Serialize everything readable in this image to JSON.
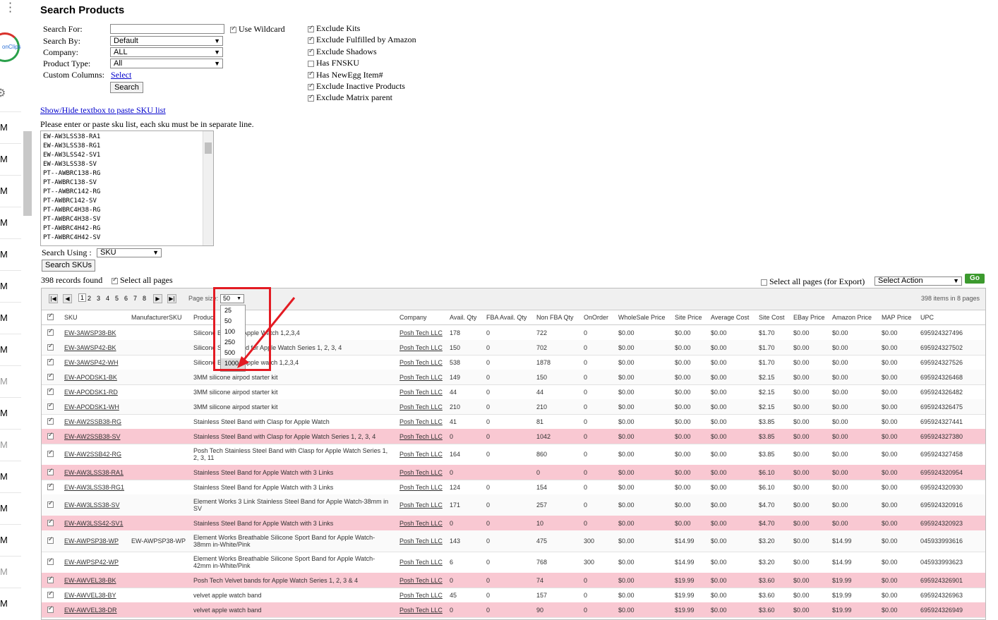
{
  "page_title": "Search Products",
  "form": {
    "search_for_label": "Search For:",
    "search_for_value": "",
    "use_wildcard_label": "Use Wildcard",
    "search_by_label": "Search By:",
    "search_by_value": "Default",
    "company_label": "Company:",
    "company_value": "ALL",
    "product_type_label": "Product Type:",
    "product_type_value": "All",
    "custom_columns_label": "Custom Columns:",
    "custom_columns_link": "Select",
    "search_button": "Search"
  },
  "filters": [
    {
      "label": "Exclude Kits",
      "checked": true
    },
    {
      "label": "Exclude Fulfilled by Amazon",
      "checked": true
    },
    {
      "label": "Exclude Shadows",
      "checked": true
    },
    {
      "label": "Has FNSKU",
      "checked": false
    },
    {
      "label": "Has NewEgg Item#",
      "checked": true
    },
    {
      "label": "Exclude Inactive Products",
      "checked": true
    },
    {
      "label": "Exclude Matrix parent",
      "checked": true
    }
  ],
  "sku_list": {
    "toggle_link": "Show/Hide textbox to paste SKU list",
    "instruction": "Please enter or paste sku list, each sku must be in separate line.",
    "lines": [
      "EW-AW3LSS38-RA1",
      "EW-AW3LSS38-RG1",
      "EW-AW3LSS42-SV1",
      "EW-AW3LSS38-SV",
      "PT--AWBRC138-RG",
      "PT-AWBRC138-SV",
      "PT--AWBRC142-RG",
      "PT-AWBRC142-SV",
      "PT-AWBRC4H38-RG",
      "PT-AWBRC4H38-SV",
      "PT-AWBRC4H42-RG",
      "PT-AWBRC4H42-SV"
    ],
    "search_using_label": "Search Using :",
    "search_using_value": "SKU",
    "search_skus_button": "Search SKUs"
  },
  "records": {
    "found_text": "398 records found",
    "select_all_label": "Select all pages",
    "export_label": "Select all pages (for Export)",
    "action_value": "Select Action",
    "go_button": "Go"
  },
  "pager": {
    "pages": [
      "1",
      "2",
      "3",
      "4",
      "5",
      "6",
      "7",
      "8"
    ],
    "current_page": "1",
    "page_size_label": "Page size:",
    "page_size_value": "50",
    "page_size_options": [
      "25",
      "50",
      "100",
      "250",
      "500",
      "1000"
    ],
    "summary": "398 items in 8 pages"
  },
  "columns": [
    "SKU",
    "ManufacturerSKU",
    "Product",
    "Company",
    "Avail. Qty",
    "FBA Avail. Qty",
    "Non FBA Qty",
    "OnOrder",
    "WholeSale Price",
    "Site Price",
    "Average Cost",
    "Site Cost",
    "EBay Price",
    "Amazon Price",
    "MAP Price",
    "UPC"
  ],
  "rows": [
    {
      "sku": "EW-3AWSP38-BK",
      "msku": "",
      "product": "Silicone Band for Apple Watch 1,2,3,4",
      "company": "Posh Tech LLC",
      "avail": "178",
      "fba": "0",
      "nonfba": "722",
      "onorder": "0",
      "wholesale": "$0.00",
      "site": "$0.00",
      "avg": "$0.00",
      "sitecost": "$1.70",
      "ebay": "$0.00",
      "amazon": "$0.00",
      "map": "$0.00",
      "upc": "695924327496",
      "pink": false
    },
    {
      "sku": "EW-3AWSP42-BK",
      "msku": "",
      "product": "Silicone Sport Band for Apple Watch Series 1, 2, 3, 4",
      "company": "Posh Tech LLC",
      "avail": "150",
      "fba": "0",
      "nonfba": "702",
      "onorder": "0",
      "wholesale": "$0.00",
      "site": "$0.00",
      "avg": "$0.00",
      "sitecost": "$1.70",
      "ebay": "$0.00",
      "amazon": "$0.00",
      "map": "$0.00",
      "upc": "695924327502",
      "pink": false
    },
    {
      "sku": "EW-3AWSP42-WH",
      "msku": "",
      "product": "Silicone Band for Apple watch 1,2,3,4",
      "company": "Posh Tech LLC",
      "avail": "538",
      "fba": "0",
      "nonfba": "1878",
      "onorder": "0",
      "wholesale": "$0.00",
      "site": "$0.00",
      "avg": "$0.00",
      "sitecost": "$1.70",
      "ebay": "$0.00",
      "amazon": "$0.00",
      "map": "$0.00",
      "upc": "695924327526",
      "pink": false
    },
    {
      "sku": "EW-APODSK1-BK",
      "msku": "",
      "product": "3MM silicone airpod starter kit",
      "company": "Posh Tech LLC",
      "avail": "149",
      "fba": "0",
      "nonfba": "150",
      "onorder": "0",
      "wholesale": "$0.00",
      "site": "$0.00",
      "avg": "$0.00",
      "sitecost": "$2.15",
      "ebay": "$0.00",
      "amazon": "$0.00",
      "map": "$0.00",
      "upc": "695924326468",
      "pink": false
    },
    {
      "sku": "EW-APODSK1-RD",
      "msku": "",
      "product": "3MM silicone airpod starter kit",
      "company": "Posh Tech LLC",
      "avail": "44",
      "fba": "0",
      "nonfba": "44",
      "onorder": "0",
      "wholesale": "$0.00",
      "site": "$0.00",
      "avg": "$0.00",
      "sitecost": "$2.15",
      "ebay": "$0.00",
      "amazon": "$0.00",
      "map": "$0.00",
      "upc": "695924326482",
      "pink": false
    },
    {
      "sku": "EW-APODSK1-WH",
      "msku": "",
      "product": "3MM silicone airpod starter kit",
      "company": "Posh Tech LLC",
      "avail": "210",
      "fba": "0",
      "nonfba": "210",
      "onorder": "0",
      "wholesale": "$0.00",
      "site": "$0.00",
      "avg": "$0.00",
      "sitecost": "$2.15",
      "ebay": "$0.00",
      "amazon": "$0.00",
      "map": "$0.00",
      "upc": "695924326475",
      "pink": false
    },
    {
      "sku": "EW-AW2SSB38-RG",
      "msku": "",
      "product": "Stainless Steel Band with Clasp for Apple Watch",
      "company": "Posh Tech LLC",
      "avail": "41",
      "fba": "0",
      "nonfba": "81",
      "onorder": "0",
      "wholesale": "$0.00",
      "site": "$0.00",
      "avg": "$0.00",
      "sitecost": "$3.85",
      "ebay": "$0.00",
      "amazon": "$0.00",
      "map": "$0.00",
      "upc": "695924327441",
      "pink": false
    },
    {
      "sku": "EW-AW2SSB38-SV",
      "msku": "",
      "product": "Stainless Steel Band with Clasp for Apple Watch Series 1, 2, 3, 4",
      "company": "Posh Tech LLC",
      "avail": "0",
      "fba": "0",
      "nonfba": "1042",
      "onorder": "0",
      "wholesale": "$0.00",
      "site": "$0.00",
      "avg": "$0.00",
      "sitecost": "$3.85",
      "ebay": "$0.00",
      "amazon": "$0.00",
      "map": "$0.00",
      "upc": "695924327380",
      "pink": true
    },
    {
      "sku": "EW-AW2SSB42-RG",
      "msku": "",
      "product": "Posh Tech Stainless Steel Band with Clasp for Apple Watch Series 1, 2, 3, 11",
      "company": "Posh Tech LLC",
      "avail": "164",
      "fba": "0",
      "nonfba": "860",
      "onorder": "0",
      "wholesale": "$0.00",
      "site": "$0.00",
      "avg": "$0.00",
      "sitecost": "$3.85",
      "ebay": "$0.00",
      "amazon": "$0.00",
      "map": "$0.00",
      "upc": "695924327458",
      "pink": false
    },
    {
      "sku": "EW-AW3LSS38-RA1",
      "msku": "",
      "product": "Stainless Steel Band for Apple Watch with 3 Links",
      "company": "Posh Tech LLC",
      "avail": "0",
      "fba": "",
      "nonfba": "0",
      "onorder": "0",
      "wholesale": "$0.00",
      "site": "$0.00",
      "avg": "$0.00",
      "sitecost": "$6.10",
      "ebay": "$0.00",
      "amazon": "$0.00",
      "map": "$0.00",
      "upc": "695924320954",
      "pink": true
    },
    {
      "sku": "EW-AW3LSS38-RG1",
      "msku": "",
      "product": "Stainless Steel Band for Apple Watch with 3 Links",
      "company": "Posh Tech LLC",
      "avail": "124",
      "fba": "0",
      "nonfba": "154",
      "onorder": "0",
      "wholesale": "$0.00",
      "site": "$0.00",
      "avg": "$0.00",
      "sitecost": "$6.10",
      "ebay": "$0.00",
      "amazon": "$0.00",
      "map": "$0.00",
      "upc": "695924320930",
      "pink": false
    },
    {
      "sku": "EW-AW3LSS38-SV",
      "msku": "",
      "product": "Element Works 3 Link Stainless Steel Band for Apple Watch-38mm in SV",
      "company": "Posh Tech LLC",
      "avail": "171",
      "fba": "0",
      "nonfba": "257",
      "onorder": "0",
      "wholesale": "$0.00",
      "site": "$0.00",
      "avg": "$0.00",
      "sitecost": "$4.70",
      "ebay": "$0.00",
      "amazon": "$0.00",
      "map": "$0.00",
      "upc": "695924320916",
      "pink": false
    },
    {
      "sku": "EW-AW3LSS42-SV1",
      "msku": "",
      "product": "Stainless Steel Band for Apple Watch with 3 Links",
      "company": "Posh Tech LLC",
      "avail": "0",
      "fba": "0",
      "nonfba": "10",
      "onorder": "0",
      "wholesale": "$0.00",
      "site": "$0.00",
      "avg": "$0.00",
      "sitecost": "$4.70",
      "ebay": "$0.00",
      "amazon": "$0.00",
      "map": "$0.00",
      "upc": "695924320923",
      "pink": true
    },
    {
      "sku": "EW-AWPSP38-WP",
      "msku": "EW-AWPSP38-WP",
      "product": "Element Works Breathable Silicone Sport Band for Apple Watch-38mm in-White/Pink",
      "company": "Posh Tech LLC",
      "avail": "143",
      "fba": "0",
      "nonfba": "475",
      "onorder": "300",
      "wholesale": "$0.00",
      "site": "$14.99",
      "avg": "$0.00",
      "sitecost": "$3.20",
      "ebay": "$0.00",
      "amazon": "$14.99",
      "map": "$0.00",
      "upc": "045933993616",
      "pink": false
    },
    {
      "sku": "EW-AWPSP42-WP",
      "msku": "",
      "product": "Element Works Breathable Silicone Sport Band for Apple Watch-42mm in-White/Pink",
      "company": "Posh Tech LLC",
      "avail": "6",
      "fba": "0",
      "nonfba": "768",
      "onorder": "300",
      "wholesale": "$0.00",
      "site": "$14.99",
      "avg": "$0.00",
      "sitecost": "$3.20",
      "ebay": "$0.00",
      "amazon": "$14.99",
      "map": "$0.00",
      "upc": "045933993623",
      "pink": false
    },
    {
      "sku": "EW-AWVEL38-BK",
      "msku": "",
      "product": "Posh Tech Velvet bands for Apple Watch Series 1, 2, 3 & 4",
      "company": "Posh Tech LLC",
      "avail": "0",
      "fba": "0",
      "nonfba": "74",
      "onorder": "0",
      "wholesale": "$0.00",
      "site": "$19.99",
      "avg": "$0.00",
      "sitecost": "$3.60",
      "ebay": "$0.00",
      "amazon": "$19.99",
      "map": "$0.00",
      "upc": "695924326901",
      "pink": true
    },
    {
      "sku": "EW-AWVEL38-BY",
      "msku": "",
      "product": "velvet apple watch band",
      "company": "Posh Tech LLC",
      "avail": "45",
      "fba": "0",
      "nonfba": "157",
      "onorder": "0",
      "wholesale": "$0.00",
      "site": "$19.99",
      "avg": "$0.00",
      "sitecost": "$3.60",
      "ebay": "$0.00",
      "amazon": "$19.99",
      "map": "$0.00",
      "upc": "695924326963",
      "pink": false
    },
    {
      "sku": "EW-AWVEL38-DR",
      "msku": "",
      "product": "velvet apple watch band",
      "company": "Posh Tech LLC",
      "avail": "0",
      "fba": "0",
      "nonfba": "90",
      "onorder": "0",
      "wholesale": "$0.00",
      "site": "$19.99",
      "avg": "$0.00",
      "sitecost": "$3.60",
      "ebay": "$0.00",
      "amazon": "$19.99",
      "map": "$0.00",
      "upc": "695924326949",
      "pink": true
    }
  ],
  "sidebar": {
    "logo_text": "onClips",
    "menu_items": [
      "M",
      "M",
      "M",
      "M",
      "M",
      "M",
      "M",
      "M",
      "M",
      "M",
      "M",
      "M",
      "M",
      "M",
      "M",
      "M"
    ]
  },
  "colors": {
    "highlight_row": "#f9c8d2",
    "annotation": "#e31b23",
    "link": "#0000cc",
    "go_button": "#3c9a2e"
  }
}
